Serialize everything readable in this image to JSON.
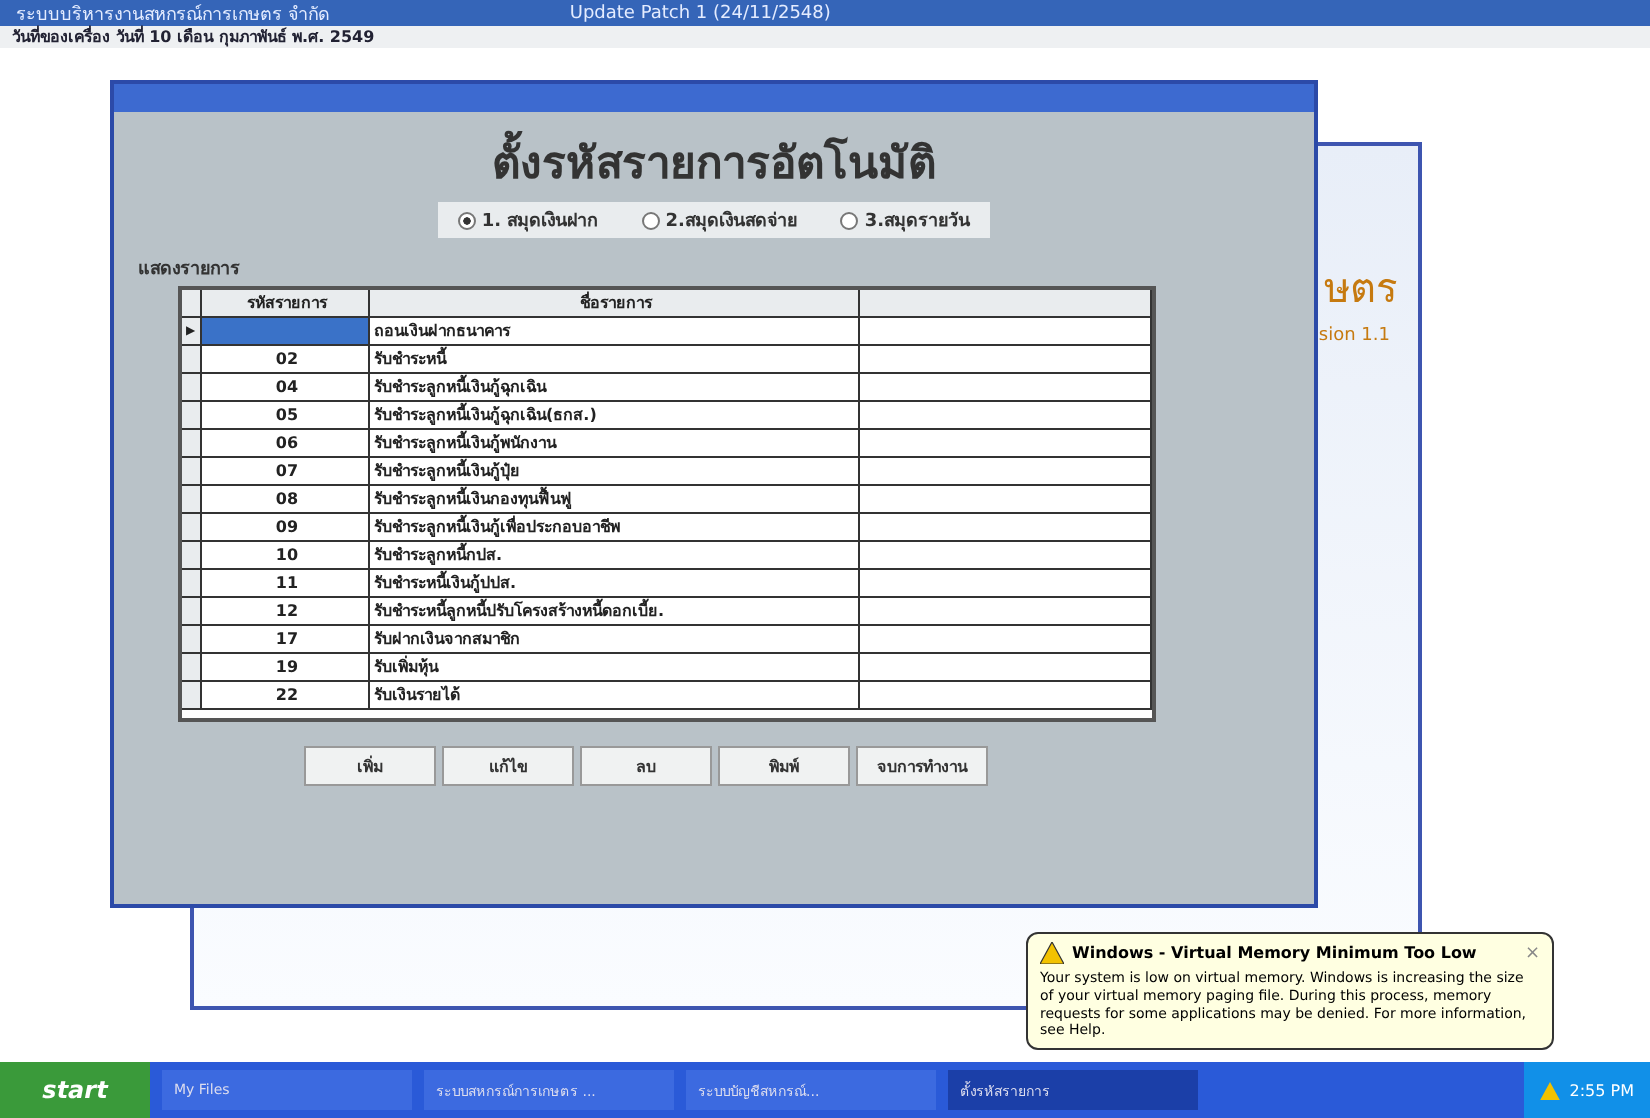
{
  "app_bar": {
    "title": "ระบบบริหารงานสหกรณ์การเกษตร จำกัด",
    "patch": "Update Patch 1 (24/11/2548)",
    "date_line": "วันที่ของเครื่อง วันที่ 10 เดือน กุมภาพันธ์ พ.ศ. 2549"
  },
  "back_window": {
    "title": "ษตร",
    "version": "sion 1.1"
  },
  "form": {
    "title": "ตั้งรหัสรายการอัตโนมัติ",
    "options": [
      {
        "label": "1. สมุดเงินฝาก",
        "selected": true
      },
      {
        "label": "2.สมุดเงินสดจ่าย",
        "selected": false
      },
      {
        "label": "3.สมุดรายวัน",
        "selected": false
      }
    ],
    "group_label": "แสดงรายการ",
    "table": {
      "columns": [
        "รหัสรายการ",
        "ชื่อรายการ"
      ],
      "row_pointer": "▶",
      "rows": [
        {
          "name": "ถอนเงินฝากธนาคาร",
          "selected": true
        },
        {
          "code": "02",
          "name": "รับชำระหนี้",
          "selected": false
        },
        {
          "code": "04",
          "name": "รับชำระลูกหนี้เงินกู้ฉุกเฉิน",
          "selected": false
        },
        {
          "code": "05",
          "name": "รับชำระลูกหนี้เงินกู้ฉุกเฉิน(ธกส.)",
          "selected": false
        },
        {
          "code": "06",
          "name": "รับชำระลูกหนี้เงินกู้พนักงาน",
          "selected": false
        },
        {
          "code": "07",
          "name": "รับชำระลูกหนี้เงินกู้ปุ๋ย",
          "selected": false
        },
        {
          "code": "08",
          "name": "รับชำระลูกหนี้เงินกองทุนฟื้นฟู",
          "selected": false
        },
        {
          "code": "09",
          "name": "รับชำระลูกหนี้เงินกู้เพื่อประกอบอาชีพ",
          "selected": false
        },
        {
          "code": "10",
          "name": "รับชำระลูกหนี้กปส.",
          "selected": false
        },
        {
          "code": "11",
          "name": "รับชำระหนี้เงินกู้ปปส.",
          "selected": false
        },
        {
          "code": "12",
          "name": "รับชำระหนี้ลูกหนี้ปรับโครงสร้างหนี้ดอกเบี้ย.",
          "selected": false
        },
        {
          "code": "17",
          "name": "รับฝากเงินจากสมาชิก",
          "selected": false
        },
        {
          "code": "19",
          "name": "รับเพิ่มหุ้น",
          "selected": false
        },
        {
          "code": "22",
          "name": "รับเงินรายได้",
          "selected": false
        }
      ]
    },
    "buttons": [
      "เพิ่ม",
      "แก้ไข",
      "ลบ",
      "พิมพ์",
      "จบการทำงาน"
    ]
  },
  "balloon": {
    "title": "Windows - Virtual Memory Minimum Too Low",
    "close": "×",
    "message": "Your system is low on virtual memory. Windows is increasing the size of your virtual memory paging file. During this process, memory requests for some applications may be denied. For more information, see Help."
  },
  "taskbar": {
    "start": "start",
    "items": [
      {
        "label": "My Files",
        "selected": false
      },
      {
        "label": "ระบบสหกรณ์การเกษตร ...",
        "selected": false
      },
      {
        "label": "ระบบบัญชีสหกรณ์...",
        "selected": false
      },
      {
        "label": "ตั้งรหัสรายการ",
        "selected": true
      }
    ],
    "clock": "2:55 PM"
  }
}
